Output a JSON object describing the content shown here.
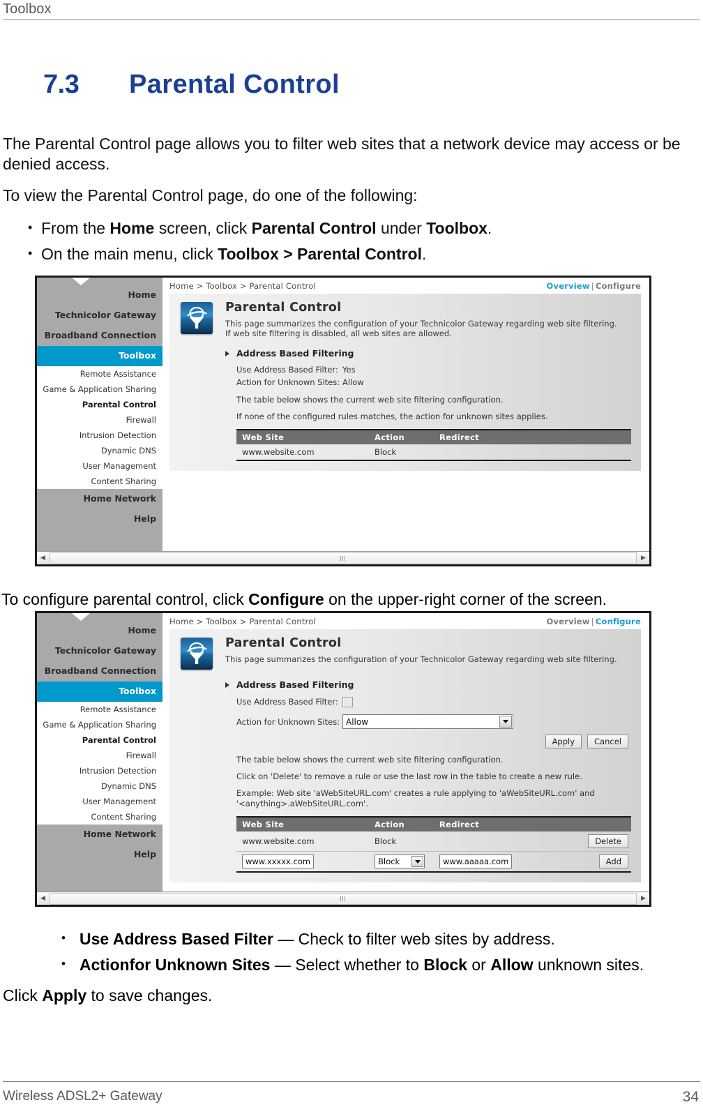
{
  "page_header": {
    "title": "Toolbox"
  },
  "section": {
    "number": "7.3",
    "name": "Parental Control"
  },
  "intro": {
    "para1": "The Parental Control page allows you to filter web sites that a network device may access or be denied access.",
    "para2": "To view the Parental Control page, do one of the following:",
    "bullet1": {
      "p1": "From the ",
      "b1": "Home",
      "p2": " screen, click ",
      "b2": "Parental Control",
      "p3": " under ",
      "b3": "Toolbox",
      "p4": "."
    },
    "bullet2": {
      "p1": "On the main menu, click ",
      "b1": "Toolbox > Parental Control",
      "p2": "."
    }
  },
  "mid_para": {
    "p1": "To configure parental control, click ",
    "b1": "Configure",
    "p2": " on the upper-right corner of the screen."
  },
  "outro": {
    "bullet1": {
      "b1": "Use Address Based Filter",
      "p1": " — Check to filter web sites by address."
    },
    "bullet2": {
      "b1": "Actionfor Unknown Sites",
      "p1": " — Select whether to ",
      "b2": "Block",
      "p2": " or ",
      "b3": "Allow",
      "p3": " unknown sites."
    },
    "apply_line": {
      "p1": "Click ",
      "b1": "Apply",
      "p2": " to save changes."
    }
  },
  "footer": {
    "left": "Wireless ADSL2+ Gateway",
    "page": "34"
  },
  "router_ui": {
    "sidebar": {
      "groups_top": [
        "Home",
        "Technicolor Gateway",
        "Broadband Connection"
      ],
      "active_group": "Toolbox",
      "sub_items": [
        "Remote Assistance",
        "Game & Application Sharing",
        "Parental Control",
        "Firewall",
        "Intrusion Detection",
        "Dynamic DNS",
        "User Management",
        "Content Sharing"
      ],
      "current_sub": "Parental Control",
      "groups_bottom": [
        "Home Network",
        "Help"
      ]
    },
    "breadcrumb": "Home > Toolbox > Parental Control",
    "tabs": {
      "overview": "Overview",
      "separator": "|",
      "configure": "Configure"
    },
    "panel_title": "Parental Control",
    "icon_name": "parental-control-filter-icon",
    "accent_blue": "#1b9fd8",
    "toolbox_highlight": "#0099cc",
    "overview": {
      "desc_line1": "This page summarizes the configuration of your Technicolor Gateway regarding web site filtering.",
      "desc_line2": "If web site filtering is disabled, all web sites are allowed.",
      "section_heading": "Address Based Filtering",
      "kv": [
        {
          "key": "Use Address Based Filter:",
          "value": "Yes"
        },
        {
          "key": "Action for Unknown Sites:",
          "value": "Allow"
        }
      ],
      "note1": "The table below shows the current web site filtering configuration.",
      "note2": "If none of the configured rules matches, the action for unknown sites applies.",
      "table": {
        "headers": [
          "Web Site",
          "Action",
          "Redirect"
        ],
        "rows": [
          {
            "site": "www.website.com",
            "action": "Block",
            "redirect": ""
          }
        ]
      }
    },
    "configure": {
      "desc_line1": "This page summarizes the configuration of your Technicolor Gateway regarding web site filtering.",
      "section_heading": "Address Based Filtering",
      "checkbox_label": "Use Address Based Filter:",
      "checkbox_checked": false,
      "select_label": "Action for Unknown Sites:",
      "select_value": "Allow",
      "select_options": [
        "Allow",
        "Block"
      ],
      "apply_label": "Apply",
      "cancel_label": "Cancel",
      "note1": "The table below shows the current web site filtering configuration.",
      "note2": "Click on 'Delete' to remove a rule or use the last row in the table to create a new rule.",
      "note3_line1": "Example: Web site 'aWebSiteURL.com' creates a rule applying to 'aWebSiteURL.com' and",
      "note3_line2": "'<anything>.aWebSiteURL.com'.",
      "table": {
        "headers": [
          "Web Site",
          "Action",
          "Redirect"
        ],
        "rows": [
          {
            "site": "www.website.com",
            "action": "Block",
            "redirect": "",
            "button": "Delete"
          }
        ],
        "new_row": {
          "site_value": "www.xxxxx.com",
          "action_value": "Block",
          "redirect_value": "www.aaaaa.com",
          "button": "Add"
        }
      }
    }
  }
}
